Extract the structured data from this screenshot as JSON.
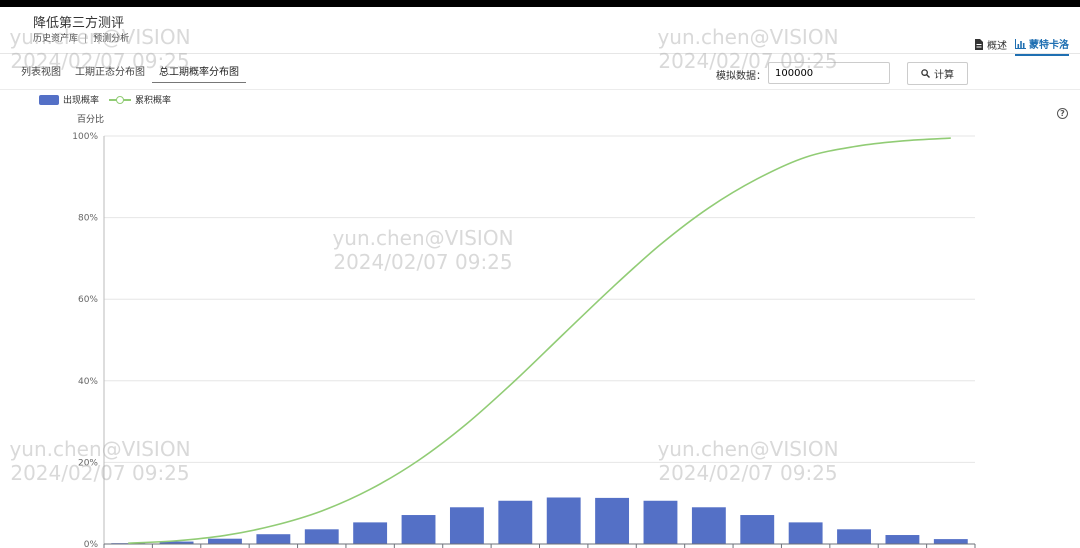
{
  "header": {
    "title": "降低第三方测评",
    "breadcrumb": [
      "历史资产库",
      "预测分析"
    ],
    "right_tabs": [
      {
        "label": "概述",
        "icon": "document-icon",
        "active": false
      },
      {
        "label": "蒙特卡洛",
        "icon": "bar-chart-icon",
        "active": true
      }
    ]
  },
  "toolbar": {
    "view_tabs": [
      {
        "label": "列表视图",
        "active": false
      },
      {
        "label": "工期正态分布图",
        "active": false
      },
      {
        "label": "总工期概率分布图",
        "active": true
      }
    ],
    "sim_label": "模拟数据：",
    "sim_value": "100000",
    "calc_label": "计算"
  },
  "watermark": {
    "line1": "yun.chen@VISION",
    "line2": "2024/02/07 09:25"
  },
  "colors": {
    "bar": "#5470c6",
    "line": "#91cc75",
    "accent": "#1f6fb2"
  },
  "chart_data": {
    "type": "bar",
    "ylabel": "百分比",
    "ylim": [
      0,
      100
    ],
    "yticks": [
      "0%",
      "20%",
      "40%",
      "60%",
      "80%",
      "100%"
    ],
    "legend_position": "top-left",
    "grid": true,
    "series": [
      {
        "name": "出现概率",
        "type": "bar",
        "values": [
          0.2,
          0.6,
          1.3,
          2.4,
          3.6,
          5.3,
          7.1,
          9.0,
          10.6,
          11.4,
          11.3,
          10.6,
          9.0,
          7.1,
          5.3,
          3.6,
          2.2,
          1.2
        ]
      },
      {
        "name": "累积概率",
        "type": "line",
        "values": [
          0.2,
          0.8,
          2.1,
          4.5,
          8.1,
          13.4,
          20.5,
          29.5,
          40.1,
          51.5,
          62.8,
          73.4,
          82.4,
          89.5,
          94.8,
          97.4,
          98.8,
          99.5
        ]
      }
    ]
  }
}
